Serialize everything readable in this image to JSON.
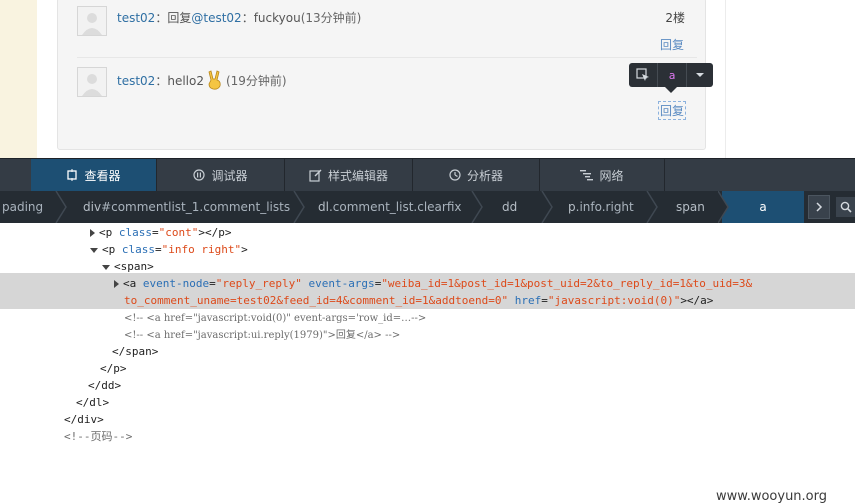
{
  "page": {
    "comments": [
      {
        "user": "test02",
        "colon": "：",
        "reply_prefix": "回复",
        "mention": "@test02",
        "mention_colon": "：",
        "text": "fuckyou",
        "time": "(13分钟前)",
        "floor": "2楼",
        "reply_label": "回复"
      },
      {
        "user": "test02",
        "colon": "：",
        "text": "hello2",
        "emoji": "victory-hand-emoji",
        "time": "(19分钟前)",
        "reply_label": "回复"
      }
    ],
    "inspector_toolbar": {
      "pick_icon": "node-picker-icon",
      "tag": "a",
      "more_icon": "caret-down-icon"
    }
  },
  "devtools": {
    "tabs": [
      {
        "label": "查看器",
        "icon": "inspector-icon",
        "active": true
      },
      {
        "label": "调试器",
        "icon": "debugger-pause-icon",
        "active": false
      },
      {
        "label": "样式编辑器",
        "icon": "style-editor-icon",
        "active": false
      },
      {
        "label": "分析器",
        "icon": "profiler-icon",
        "active": false
      },
      {
        "label": "网络",
        "icon": "network-icon",
        "active": false
      }
    ],
    "breadcrumbs": [
      {
        "tag": "",
        "rest": "pading"
      },
      {
        "tag": "div",
        "rest": "#commentlist_1.comment_lists"
      },
      {
        "tag": "dl",
        "rest": ".comment_list.clearfix"
      },
      {
        "tag": "dd",
        "rest": ""
      },
      {
        "tag": "p",
        "rest": ".info.right"
      },
      {
        "tag": "span",
        "rest": ""
      },
      {
        "tag": "a",
        "rest": "",
        "active": true
      }
    ],
    "markup": {
      "line1": {
        "open": "<p ",
        "attr": "class",
        "eq": "=",
        "val": "\"cont\"",
        "close": "></p>"
      },
      "line2": {
        "open": "<p ",
        "attr": "class",
        "eq": "=",
        "val": "\"info right\"",
        "close": ">"
      },
      "line3": {
        "text": "<span>"
      },
      "line4": {
        "open": "<a ",
        "attr1": "event-node",
        "val1": "\"reply_reply\"",
        "attr2": "event-args",
        "val2a": "\"weiba_id=1&post_id=1&post_uid=2&to_reply_id=1&to_uid=3&",
        "val2b": "to_comment_uname=test02&feed_id=4&comment_id=1&addtoend=0\"",
        "attr3": "href",
        "val3": "\"javascript:void(0)\"",
        "close": "></a>"
      },
      "line5": {
        "text": "<!--  <a href=\"javascript:void(0)\" event-args='row_id=…-->"
      },
      "line6": {
        "text": "<!--  <a href=\"javascript:ui.reply(1979)\">回复</a> -->"
      },
      "line7": {
        "text": "</span>"
      },
      "line8": {
        "text": "</p>"
      },
      "line9": {
        "text": "</dd>"
      },
      "line10": {
        "text": "</dl>"
      },
      "line11": {
        "text": "</div>"
      },
      "line12": {
        "text": "<!--页码-->"
      }
    }
  },
  "watermark": "www.wooyun.org",
  "colors": {
    "tab_active_bg": "#1d4f73",
    "toolbar_bg": "#343c45",
    "link_blue": "#2f6fa3",
    "attr_name": "#2b6fb5",
    "attr_value": "#dd4a1a",
    "selected_row": "#d6d6d6"
  }
}
